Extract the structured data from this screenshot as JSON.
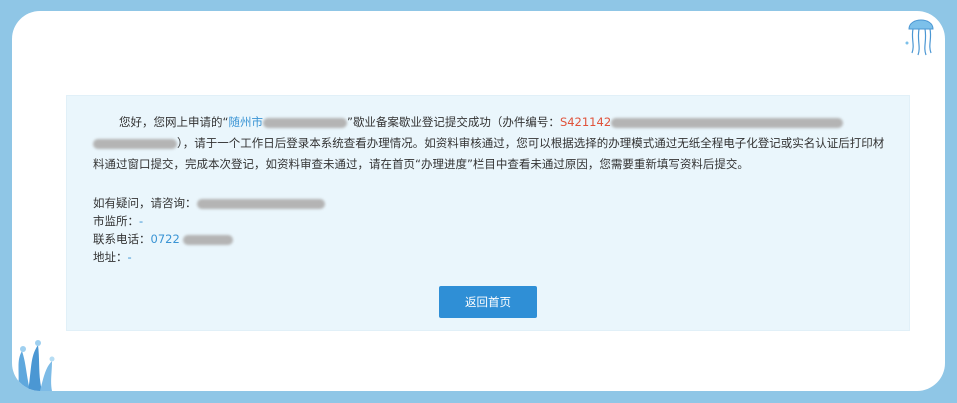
{
  "message": {
    "part1": "您好，您网上申请的",
    "quote_open": "“",
    "city": "随州市",
    "quote_close": "”",
    "part2": "歇业备案歇业登记提交成功（办件编号：",
    "case_no_prefix": "S421142",
    "part3": "），请于一个工作日后登录本系统查看办理情况。如资料审核通过，您可以根据选择的办理模式通过无纸全程电子化登记或实名认证后打印材料通过窗口提交，完成本次登记，如资料审查未通过，请在首页“办理进度”栏目中查看未通过原因，您需要重新填写资料后提交。"
  },
  "info": {
    "consult_label": "如有疑问，请咨询：",
    "bureau_label": "市监所：",
    "bureau_value": "-",
    "phone_label": "联系电话：",
    "phone_prefix": "0722",
    "address_label": "地址：",
    "address_value": "-"
  },
  "back_button": "返回首页",
  "colors": {
    "frame": "#8fc6e6",
    "panel": "#eaf6fc",
    "button": "#2f8fd6",
    "link": "#3a94d4",
    "case_no": "#e0523a"
  }
}
